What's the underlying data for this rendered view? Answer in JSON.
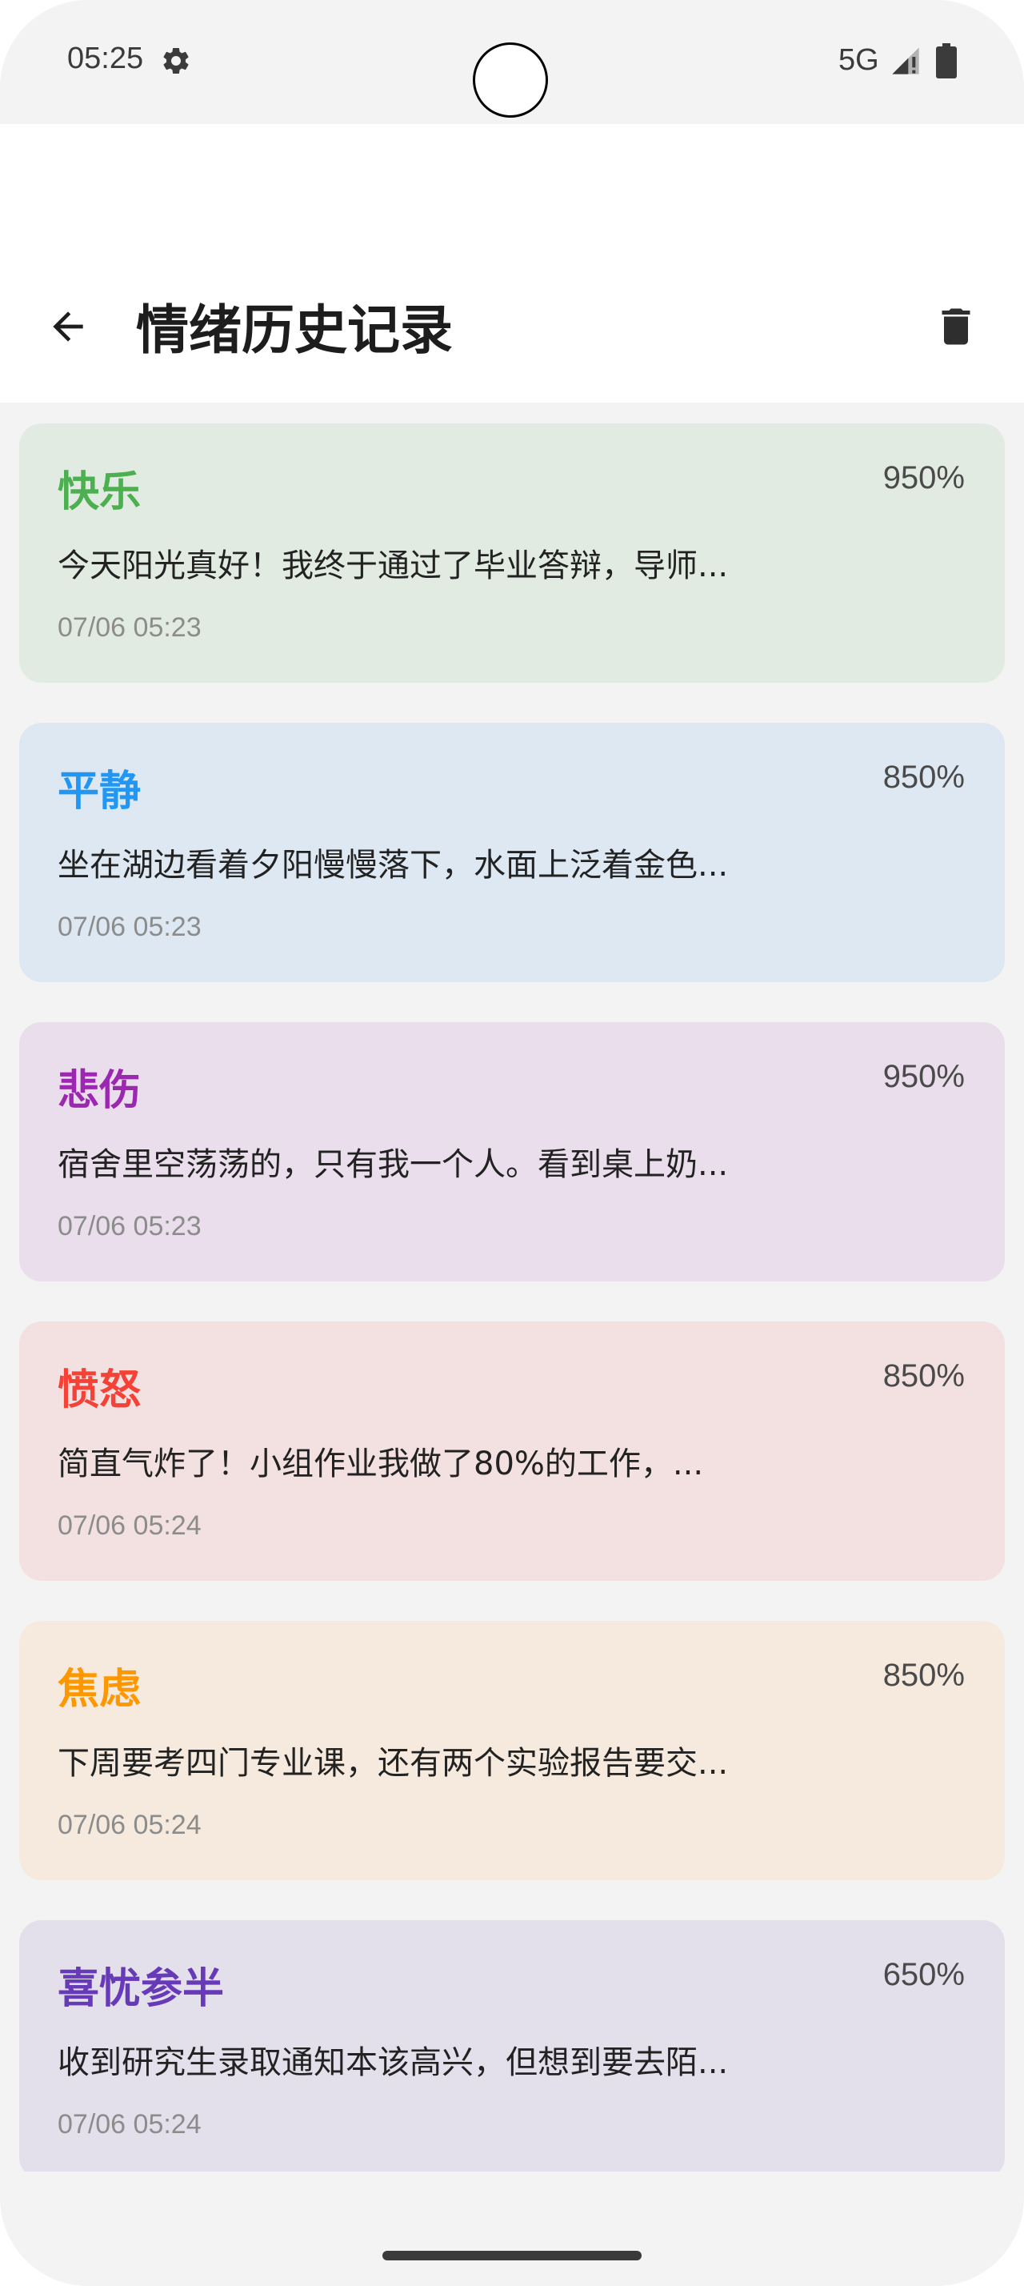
{
  "status_bar": {
    "time": "05:25",
    "network": "5G"
  },
  "header": {
    "title": "情绪历史记录"
  },
  "entries": [
    {
      "emotion": "快乐",
      "percent": "950%",
      "text": "今天阳光真好！我终于通过了毕业答辩，导师...",
      "time": "07/06 05:23",
      "accent": "#4caf50",
      "bg": "#e2ebe2"
    },
    {
      "emotion": "平静",
      "percent": "850%",
      "text": "坐在湖边看着夕阳慢慢落下，水面上泛着金色...",
      "time": "07/06 05:23",
      "accent": "#2196f3",
      "bg": "#dde8f3"
    },
    {
      "emotion": "悲伤",
      "percent": "950%",
      "text": "宿舍里空荡荡的，只有我一个人。看到桌上奶...",
      "time": "07/06 05:23",
      "accent": "#9c27b0",
      "bg": "#eaddec"
    },
    {
      "emotion": "愤怒",
      "percent": "850%",
      "text": "简直气炸了！小组作业我做了80%的工作，...",
      "time": "07/06 05:24",
      "accent": "#f44336",
      "bg": "#f3e1e1"
    },
    {
      "emotion": "焦虑",
      "percent": "850%",
      "text": "下周要考四门专业课，还有两个实验报告要交...",
      "time": "07/06 05:24",
      "accent": "#ff9800",
      "bg": "#f5eadd"
    },
    {
      "emotion": "喜忧参半",
      "percent": "650%",
      "text": "收到研究生录取通知本该高兴，但想到要去陌...",
      "time": "07/06 05:24",
      "accent": "#673ab7",
      "bg": "#e3e0eb"
    }
  ]
}
